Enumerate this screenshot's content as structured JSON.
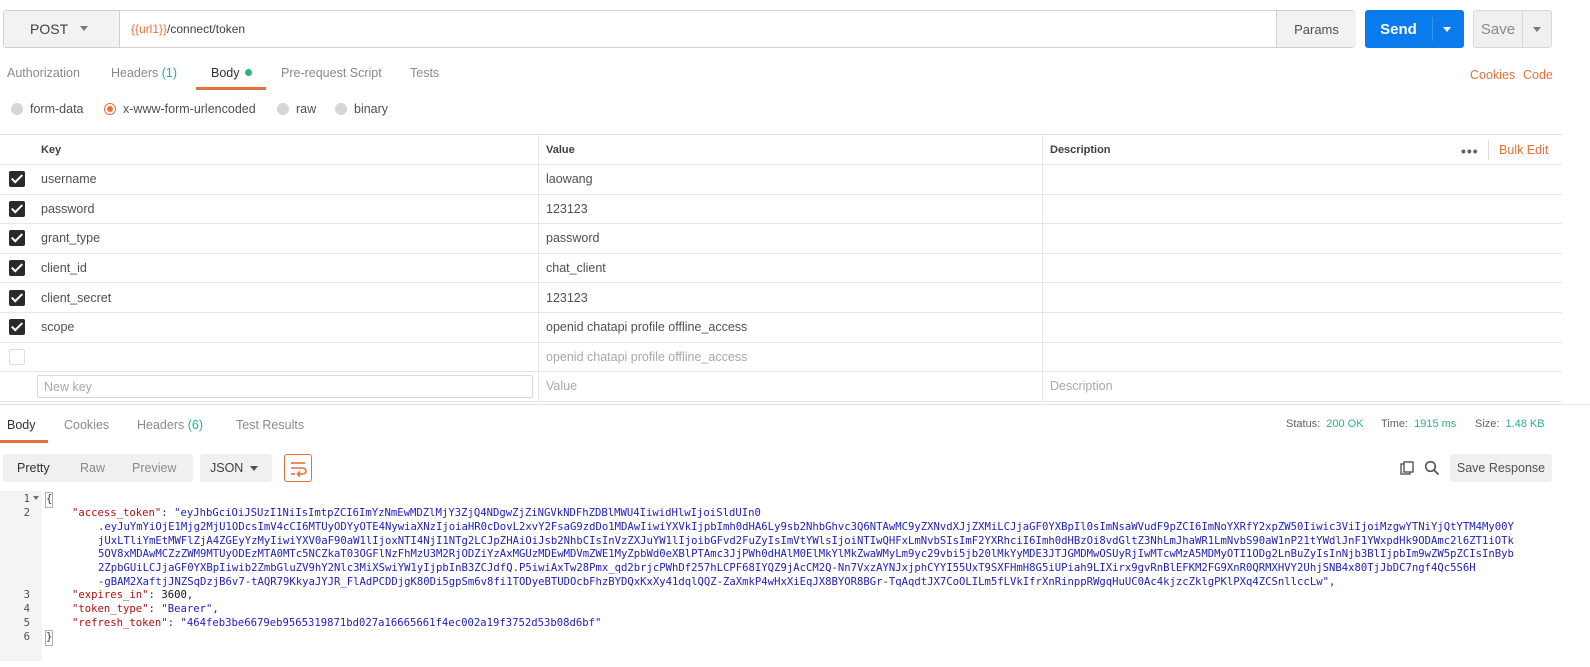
{
  "request": {
    "method": "POST",
    "url_var": "{{url1}}",
    "url_path": "/connect/token",
    "params_label": "Params",
    "send_label": "Send",
    "save_label": "Save"
  },
  "request_tabs": {
    "authorization": "Authorization",
    "headers": "Headers",
    "headers_count": "(1)",
    "body": "Body",
    "prerequest": "Pre-request Script",
    "tests": "Tests",
    "cookies": "Cookies",
    "code": "Code"
  },
  "body_modes": {
    "form_data": "form-data",
    "urlencoded": "x-www-form-urlencoded",
    "raw": "raw",
    "binary": "binary",
    "selected": "x-www-form-urlencoded"
  },
  "params_table": {
    "headers": {
      "key": "Key",
      "value": "Value",
      "description": "Description",
      "bulk_edit": "Bulk Edit",
      "more": "•••"
    },
    "rows": [
      {
        "checked": true,
        "key": "username",
        "value": "laowang",
        "description": ""
      },
      {
        "checked": true,
        "key": "password",
        "value": "123123",
        "description": ""
      },
      {
        "checked": true,
        "key": "grant_type",
        "value": "password",
        "description": ""
      },
      {
        "checked": true,
        "key": "client_id",
        "value": "chat_client",
        "description": ""
      },
      {
        "checked": true,
        "key": "client_secret",
        "value": "123123",
        "description": ""
      },
      {
        "checked": true,
        "key": "scope",
        "value": "openid chatapi profile offline_access",
        "description": ""
      },
      {
        "checked": false,
        "key": "",
        "value": "openid chatapi profile offline_access",
        "description": ""
      }
    ],
    "new_row": {
      "key_placeholder": "New key",
      "value_placeholder": "Value",
      "description_placeholder": "Description"
    }
  },
  "response_tabs": {
    "body": "Body",
    "cookies": "Cookies",
    "headers": "Headers",
    "headers_count": "(6)",
    "test_results": "Test Results",
    "status_label": "Status:",
    "status_value": "200 OK",
    "time_label": "Time:",
    "time_value": "1915 ms",
    "size_label": "Size:",
    "size_value": "1.48 KB"
  },
  "response_toolbar": {
    "pretty": "Pretty",
    "raw": "Raw",
    "preview": "Preview",
    "format": "JSON",
    "save_response": "Save Response"
  },
  "response_body": {
    "line_numbers": [
      "1",
      "2",
      "3",
      "4",
      "5",
      "6"
    ],
    "open_brace": "{",
    "close_brace": "}",
    "access_token_key": "\"access_token\"",
    "access_token_lines": [
      "\"eyJhbGciOiJSUzI1NiIsImtpZCI6ImYzNmEwMDZlMjY3ZjQ4NDgwZjZiNGVkNDFhZDBlMWU4IiwidHlwIjoiSldUIn0",
      ".eyJuYmYiOjE1Mjg2MjU1ODcsImV4cCI6MTUyODYyOTE4NywiaXNzIjoiaHR0cDovL2xvY2FsaG9zdDo1MDAwIiwiYXVkIjpbImh0dHA6Ly9sb2NhbGhvc3Q6NTAwMC9yZXNvdXJjZXMiLCJjaGF0YXBpIl0sImNsaWVudF9pZCI6ImNoYXRfY2xpZW50Iiwic3ViIjoiMzgwYTNiYjQtYTM4My00Y",
      "jUxLTliYmEtMWFlZjA4ZGEyYzMyIiwiYXV0aF90aW1lIjoxNTI4NjI1NTg2LCJpZHAiOiJsb2NhbCIsInVzZXJuYW1lIjoibGFvd2FuZyIsImVtYWlsIjoiNTIwQHFxLmNvbSIsImF2YXRhciI6Imh0dHBzOi8vdGltZ3NhLmJhaWR1LmNvbS90aW1nP21tYWdlJnF1YWxpdHk9ODAmc2l6ZT1iOTk",
      "5OV8xMDAwMCZzZWM9MTUyODEzMTA0MTc5NCZkaT03OGFlNzFhMzU3M2RjODZiYzAxMGUzMDEwMDVmZWE1MyZpbWd0eXBlPTAmc3JjPWh0dHAlM0ElMkYlMkZwaWMyLm9yc29vbi5jb20lMkYyMDE3JTJGMDMwOSUyRjIwMTcwMzA5MDMyOTI1ODg2LnBuZyIsInNjb3BlIjpbIm9wZW5pZCIsInByb",
      "2ZpbGUiLCJjaGF0YXBpIiwib2ZmbGluZV9hY2Nlc3MiXSwiYW1yIjpbInB3ZCJdfQ.P5iwiAxTw28Pmx_qd2brjcPWhDf257hLCPF68IYQZ9jAcCM2Q-Nn7VxzAYNJxjphCYYI55UxT9SXFHmH8G5iUPiah9LIXirx9gvRnBlEFKM2FG9XnR0QRMXHVY2UhjSNB4x80TjJbDC7ngf4Qc5S6H",
      "-gBAM2XaftjJNZSqDzjB6v7-tAQR79KkyaJYJR_FlAdPCDDjgK80Di5gpSm6v8fi1TODyeBTUDOcbFhzBYDQxKxXy41dqlQQZ-ZaXmkP4wHxXiEqJX8BYOR8BGr-TqAqdtJX7CoOLILm5fLVkIfrXnRinppRWgqHuUC0Ac4kjzcZklgPKlPXq4ZCSnllccLw\","
    ],
    "expires_in_key": "\"expires_in\"",
    "expires_in_value": "3600",
    "token_type_key": "\"token_type\"",
    "token_type_value": "\"Bearer\"",
    "refresh_token_key": "\"refresh_token\"",
    "refresh_token_value": "\"464feb3be6679eb9565319871bd027a16665661f4ec002a19f3752d53b08d6bf\""
  },
  "colors": {
    "accent_orange": "#e8703a",
    "send_blue": "#097bed",
    "success_green": "#26b47f"
  }
}
